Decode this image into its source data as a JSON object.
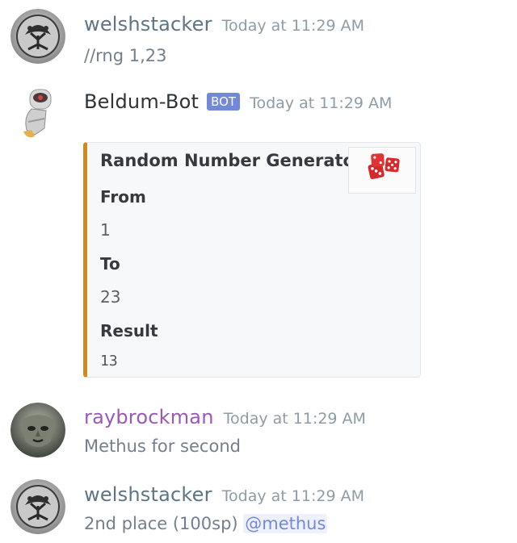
{
  "messages": [
    {
      "username": "welshstacker",
      "timestamp": "Today at 11:29 AM",
      "text": "//rng 1,23",
      "avatar_icon": "tree-of-life-icon"
    },
    {
      "username": "Beldum-Bot",
      "bot_tag": "BOT",
      "timestamp": "Today at 11:29 AM",
      "avatar_icon": "robot-icon",
      "embed": {
        "title": "Random Number Generator",
        "thumbnail_icon": "dice-icon",
        "accent_color": "#d18a1f",
        "fields": [
          {
            "name": "From",
            "value": "1"
          },
          {
            "name": "To",
            "value": "23"
          },
          {
            "name": "Result",
            "value": "13"
          }
        ]
      }
    },
    {
      "username": "raybrockman",
      "timestamp": "Today at 11:29 AM",
      "text": "Methus for second",
      "avatar_icon": "gargoyle-icon"
    },
    {
      "username": "welshstacker",
      "timestamp": "Today at 11:29 AM",
      "text_prefix": "2nd place (100sp) ",
      "mention": "@methus",
      "avatar_icon": "tree-of-life-icon"
    }
  ],
  "colors": {
    "username_default": "#5f7482",
    "username_raybrockman": "#9b59b6",
    "bot_tag_bg": "#7289da",
    "mention": "#7289da"
  }
}
